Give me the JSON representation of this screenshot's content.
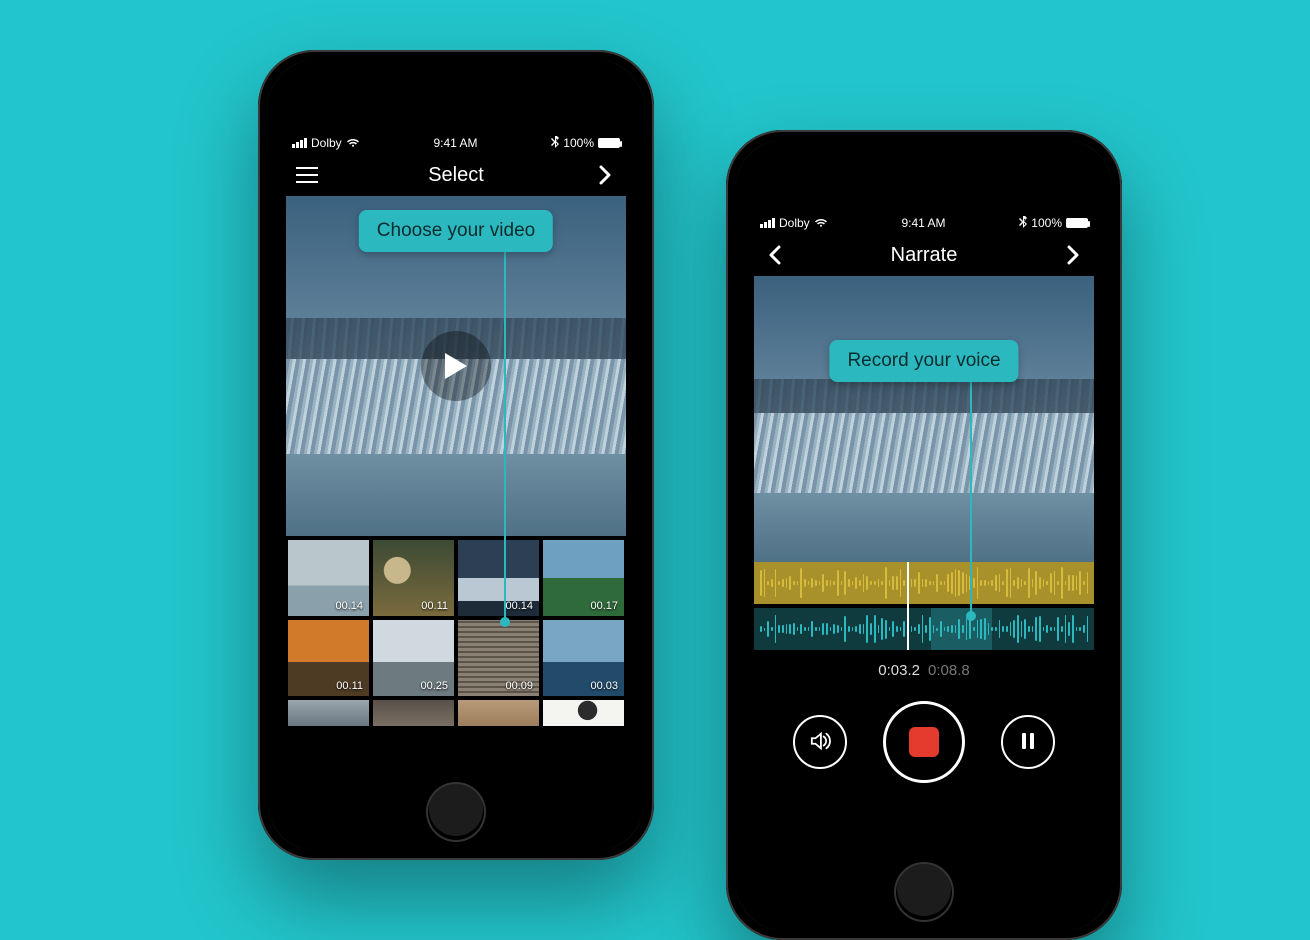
{
  "statusbar": {
    "carrier": "Dolby",
    "time": "9:41 AM",
    "battery_text": "100%"
  },
  "left_phone": {
    "nav_title": "Select",
    "callout": "Choose your video",
    "thumbs_row1": [
      {
        "duration": "00.14"
      },
      {
        "duration": "00.11"
      },
      {
        "duration": "00.14"
      },
      {
        "duration": "00.17"
      }
    ],
    "thumbs_row2": [
      {
        "duration": "00.11"
      },
      {
        "duration": "00.25"
      },
      {
        "duration": "00.09"
      },
      {
        "duration": "00.03"
      }
    ]
  },
  "right_phone": {
    "nav_title": "Narrate",
    "callout": "Record your voice",
    "time_current": "0:03.2",
    "time_total": "0:08.8"
  }
}
